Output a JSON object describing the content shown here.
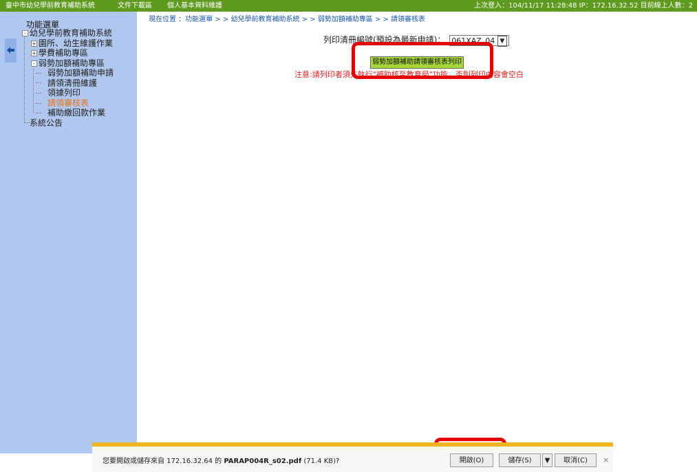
{
  "topbar": {
    "nav": [
      "臺中市幼兒學前教育補助系統",
      "文件下載區",
      "個人基本資料維護"
    ],
    "status": "上次登入：104/11/17 11:28:48 IP：172.16.32.52 目前線上人數：2",
    "bg_color": "#5d9a1e"
  },
  "sidebar": {
    "title": "功能選單",
    "tree": {
      "root": "幼兒學前教育補助系統",
      "n1": "園所、幼生維護作業",
      "n2": "學費補助專區",
      "n3": "弱勢加額補助專區",
      "c1": "弱勢加額補助申請",
      "c2": "請領清冊維護",
      "c3": "領據列印",
      "c4": "請領審核表",
      "c5": "補助繳回款作業",
      "announce": "系統公告"
    },
    "toggle_expand": "+",
    "toggle_collapse": "-",
    "collapse_icon": "arrow-left-icon"
  },
  "main": {
    "breadcrumb": "現在位置 ：功能選單 > > 幼兒學前教育補助系統 > > 弱勢加額補助專區 > > 請領審核表",
    "select_label": "列印清冊編號(預設為最新申請)：",
    "select_value": "061XAZ_04",
    "print_button": "弱勢加額補助請領審核表列印",
    "note": "注意:請列印者須先執行\"補助核至教育局\"功能，否則列印內容會空白"
  },
  "download_bar": {
    "message_prefix": "您要開啟或儲存來自 172.16.32.64 的 ",
    "file_name": "PARAP004R_s02.pdf",
    "file_size": " (71.4 KB)?",
    "open_button": "開啟(O)",
    "save_button": "儲存(S)",
    "cancel_button": "取消(C)",
    "close_glyph": "×",
    "accent_color": "#f0b51c"
  },
  "highlight_color": "#e60000"
}
